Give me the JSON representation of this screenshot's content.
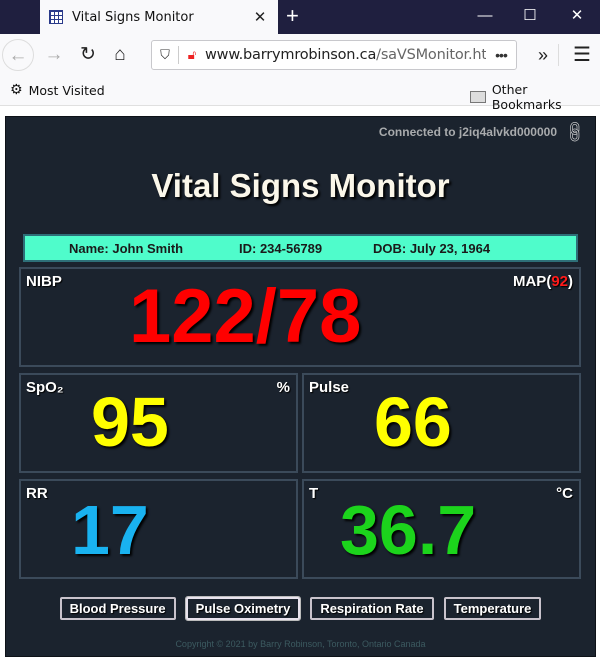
{
  "browser": {
    "tab_title": "Vital Signs Monitor",
    "new_tab_label": "+",
    "window_controls": {
      "minimize": "—",
      "maximize": "☐",
      "close": "✕"
    },
    "url_host": "www.barrymrobinson.ca",
    "url_path": "/saVSMonitor.html",
    "url_more": "•••",
    "bookmarks": {
      "most_visited": "Most Visited",
      "other": "Other Bookmarks"
    }
  },
  "monitor": {
    "connection": "Connected to j2iq4alvkd000000",
    "title": "Vital Signs Monitor",
    "patient": {
      "name": "Name: John Smith",
      "id": "ID: 234-56789",
      "dob": "DOB: July 23, 1964"
    },
    "nibp": {
      "label": "NIBP",
      "value": "122/78",
      "map_prefix": "MAP(",
      "map_value": "92",
      "map_suffix": ")",
      "color": "#ff0000"
    },
    "spo2": {
      "label": "SpO₂",
      "unit": "%",
      "value": "95",
      "color": "#ffff00"
    },
    "pulse": {
      "label": "Pulse",
      "value": "66",
      "color": "#ffff00"
    },
    "rr": {
      "label": "RR",
      "value": "17",
      "color": "#19b2f0"
    },
    "temp": {
      "label": "T",
      "unit": "°C",
      "value": "36.7",
      "color": "#1cd41c"
    },
    "buttons": [
      "Blood Pressure",
      "Pulse Oximetry",
      "Respiration Rate",
      "Temperature"
    ],
    "active_button": "Pulse Oximetry",
    "copyright": "Copyright © 2021 by Barry Robinson, Toronto, Ontario Canada"
  }
}
